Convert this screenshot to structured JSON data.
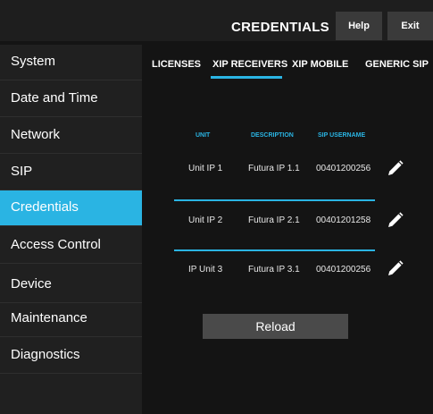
{
  "header": {
    "title": "CREDENTIALS",
    "help_label": "Help",
    "exit_label": "Exit"
  },
  "sidebar": {
    "items": [
      {
        "label": "System"
      },
      {
        "label": "Date and Time"
      },
      {
        "label": "Network"
      },
      {
        "label": "SIP"
      },
      {
        "label": "Credentials",
        "active": true
      },
      {
        "label": "Access Control"
      },
      {
        "label": "Device"
      },
      {
        "label": "Maintenance"
      },
      {
        "label": "Diagnostics"
      }
    ]
  },
  "tabs": [
    {
      "label": "LICENSES"
    },
    {
      "label": "XIP RECEIVERS",
      "active": true
    },
    {
      "label": "XIP MOBILE"
    },
    {
      "label": "GENERIC SIP"
    }
  ],
  "table": {
    "columns": [
      "UNIT",
      "DESCRIPTION",
      "SIP USERNAME"
    ],
    "rows": [
      {
        "unit": "Unit IP 1",
        "description": "Futura IP 1.1",
        "sip_username": "00401200256"
      },
      {
        "unit": "Unit IP 2",
        "description": "Futura IP 2.1",
        "sip_username": "00401201258"
      },
      {
        "unit": "IP Unit 3",
        "description": "Futura IP 3.1",
        "sip_username": "00401200256"
      }
    ]
  },
  "reload_label": "Reload",
  "colors": {
    "accent": "#2ab4e3",
    "background": "#141414",
    "sidebar": "#202020",
    "button": "#4a4a4a"
  },
  "icons": {
    "edit": "pencil-icon"
  }
}
